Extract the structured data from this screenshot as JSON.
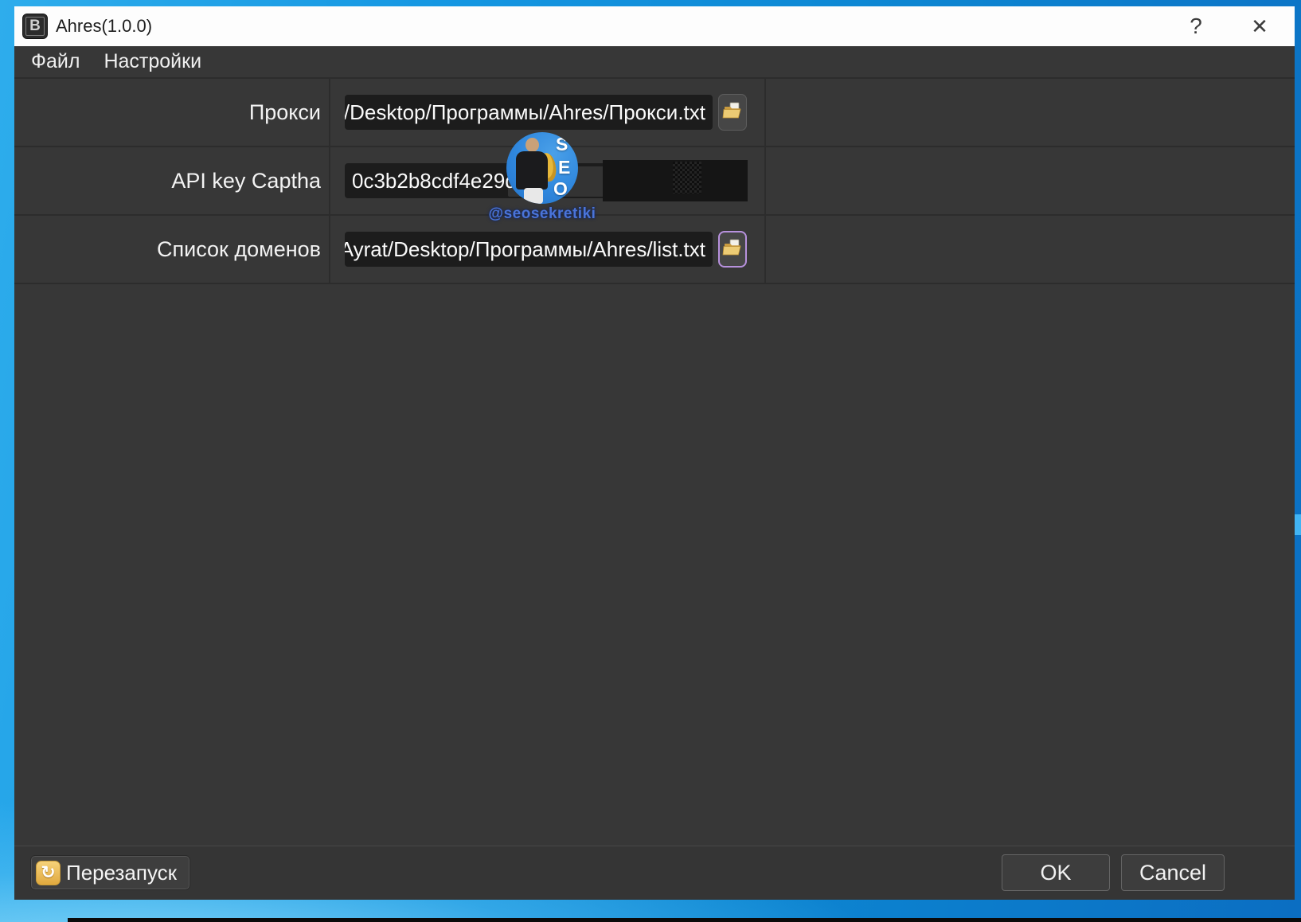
{
  "window": {
    "title": "Ahres(1.0.0)",
    "help_glyph": "?",
    "close_glyph": "✕",
    "app_icon_glyph": "B"
  },
  "menu": {
    "items": [
      "Файл",
      "Настройки"
    ]
  },
  "form": {
    "rows": [
      {
        "label": "Прокси",
        "value": "rat/Desktop/Программы/Ahres/Прокси.txt",
        "has_browse": true
      },
      {
        "label": "API key Captha",
        "value": "0c3b2b8cdf4e29d",
        "has_browse": false
      },
      {
        "label": "Список доменов",
        "value": "s/Ayrat/Desktop/Программы/Ahres/list.txt",
        "has_browse": true
      }
    ]
  },
  "watermark": {
    "handle": "@seosekretiki",
    "letters": [
      "S",
      "E",
      "O"
    ]
  },
  "footer": {
    "restart_label": "Перезапуск",
    "restart_glyph": "↻",
    "ok_label": "OK",
    "cancel_label": "Cancel"
  },
  "colors": {
    "desktop_blue": "#1597e2",
    "titlebar_white": "#fdfdfd",
    "panel_dark": "#373737",
    "field_dark": "#1c1c1c",
    "folder_yellow": "#eccb74",
    "focus_violet": "#b791dd",
    "restart_orange": "#e8a93e",
    "watermark_blue": "#4a74d8"
  }
}
